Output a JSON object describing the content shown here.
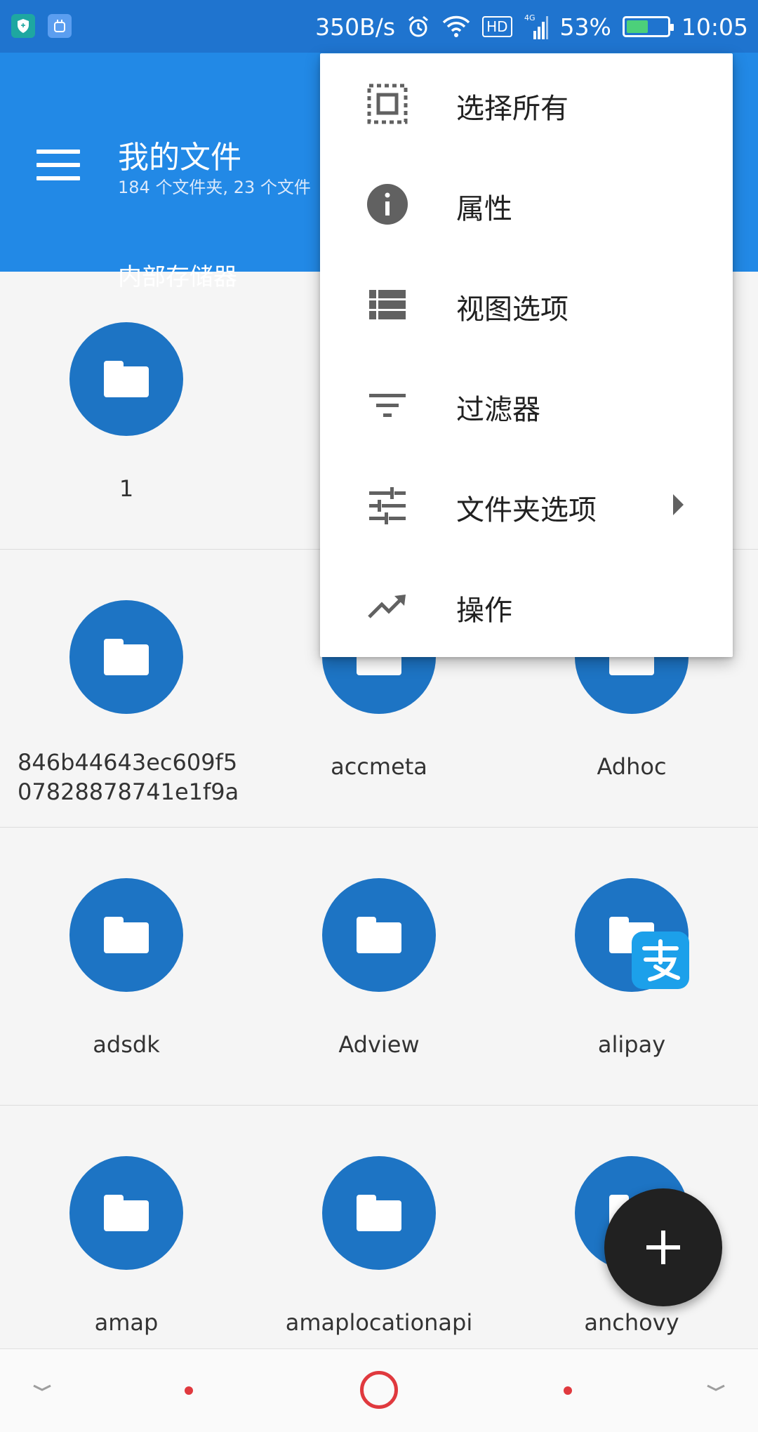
{
  "status_bar": {
    "speed": "350B/s",
    "battery_percent": "53%",
    "battery_level": 0.53,
    "time": "10:05",
    "hd_label": "HD",
    "network": "4G",
    "icons": [
      "shield-app-icon",
      "android-app-icon",
      "alarm-icon",
      "wifi-icon",
      "signal-icon",
      "battery-icon"
    ]
  },
  "appbar": {
    "title": "我的文件",
    "subtitle": "184 个文件夹, 23 个文件",
    "tab_label": "内部存储器",
    "menu_icon": "hamburger-icon"
  },
  "menu": {
    "items": [
      {
        "label": "选择所有",
        "icon": "select-all-icon"
      },
      {
        "label": "属性",
        "icon": "info-icon"
      },
      {
        "label": "视图选项",
        "icon": "view-list-icon"
      },
      {
        "label": "过滤器",
        "icon": "filter-icon"
      },
      {
        "label": "文件夹选项",
        "icon": "tune-icon",
        "has_submenu": true
      },
      {
        "label": "操作",
        "icon": "trending-icon"
      }
    ]
  },
  "grid": {
    "rows": [
      [
        {
          "name": "1"
        },
        {
          "name": ""
        },
        {
          "name": ""
        }
      ],
      [
        {
          "name": "846b44643ec609f507828878741e1f9a",
          "line1": "846b44643ec609f5",
          "line2": "07828878741e1f9a"
        },
        {
          "name": "accmeta"
        },
        {
          "name": "Adhoc"
        }
      ],
      [
        {
          "name": "adsdk"
        },
        {
          "name": "Adview"
        },
        {
          "name": "alipay",
          "badge": "alipay-badge-icon"
        }
      ],
      [
        {
          "name": "amap"
        },
        {
          "name": "amaplocationapi"
        },
        {
          "name": "anchovy"
        }
      ]
    ]
  },
  "fab": {
    "icon": "plus-icon"
  },
  "colors": {
    "appbar": "#2289e6",
    "statusbar": "#1f74cf",
    "folder": "#1d74c4",
    "fab": "#212121",
    "nav_accent": "#e0393e",
    "alipay": "#1ca0ea"
  }
}
